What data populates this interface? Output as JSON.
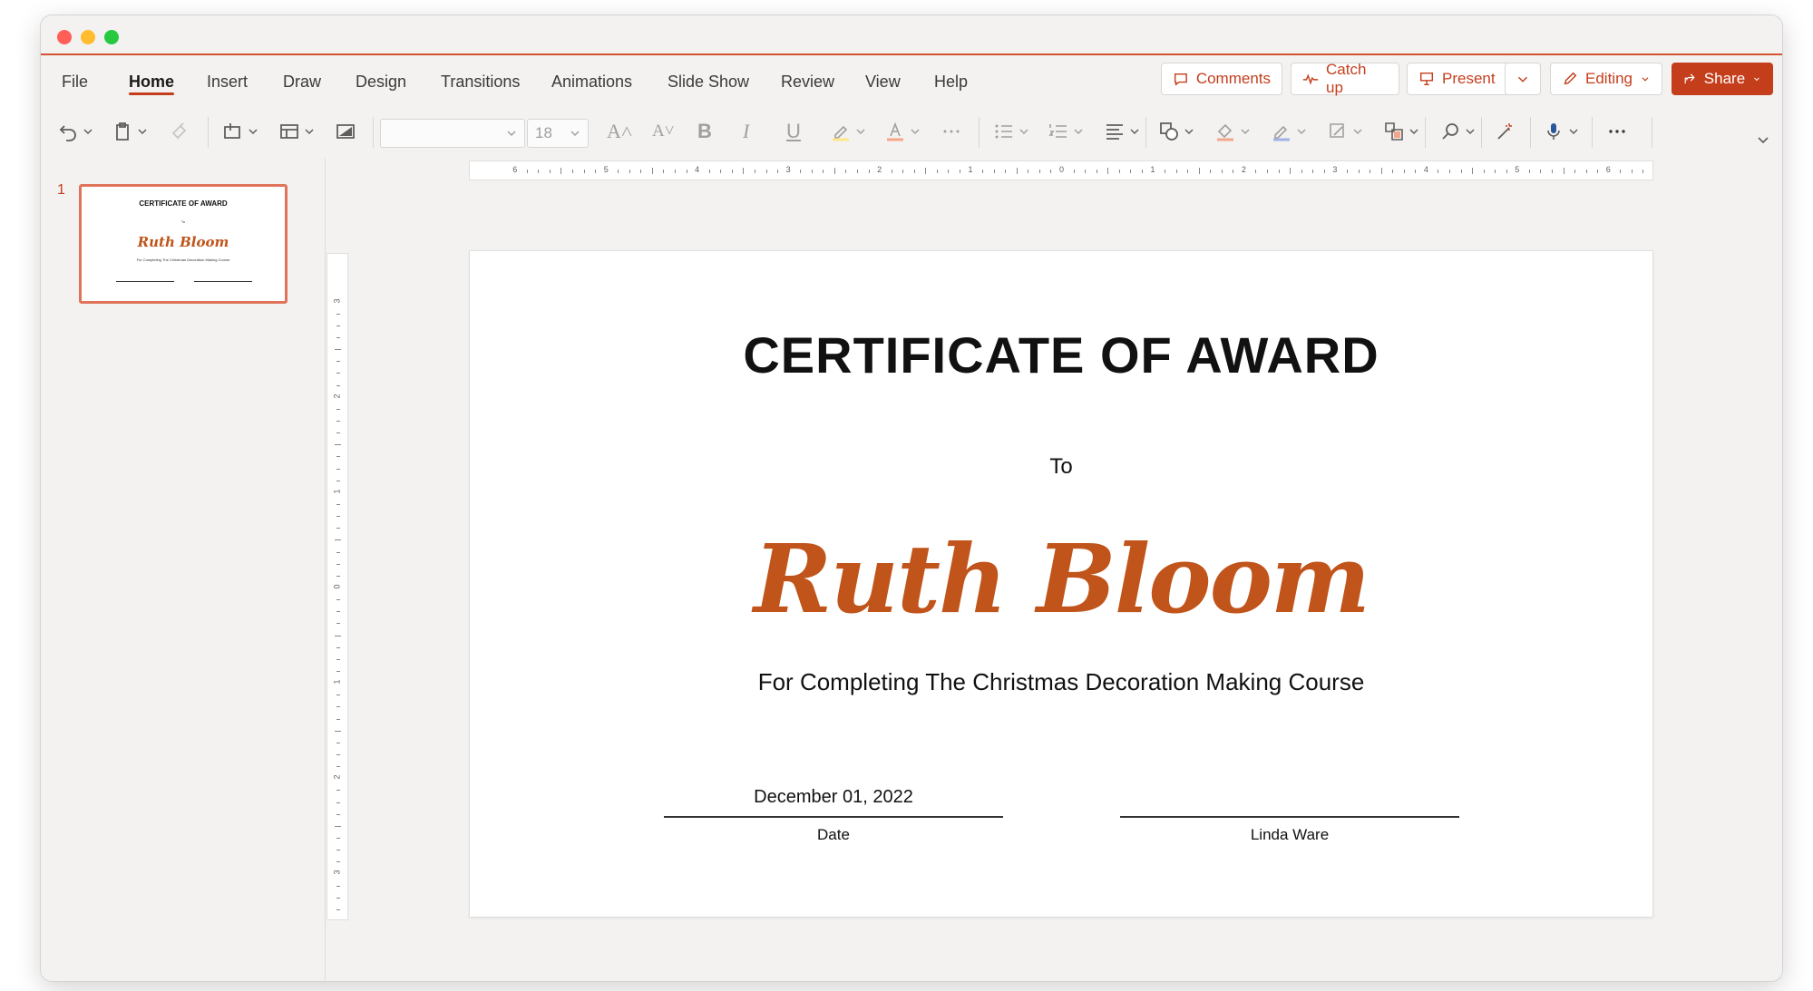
{
  "colors": {
    "accent": "#c43e1c",
    "name_color": "#c0541a",
    "thumb_border": "#e0745a"
  },
  "ribbon": {
    "tabs": [
      {
        "label": "File"
      },
      {
        "label": "Home"
      },
      {
        "label": "Insert"
      },
      {
        "label": "Draw"
      },
      {
        "label": "Design"
      },
      {
        "label": "Transitions"
      },
      {
        "label": "Animations"
      },
      {
        "label": "Slide Show"
      },
      {
        "label": "Review"
      },
      {
        "label": "View"
      },
      {
        "label": "Help"
      }
    ],
    "active_tab": "Home",
    "buttons": {
      "comments": "Comments",
      "catch_up": "Catch up",
      "present": "Present",
      "editing": "Editing",
      "share": "Share"
    }
  },
  "toolbar": {
    "font_size": "18",
    "icons": [
      "undo-icon",
      "clipboard-icon",
      "format-painter-icon",
      "new-slide-icon",
      "layout-icon",
      "background-icon",
      "increase-font-icon",
      "decrease-font-icon",
      "bold-icon",
      "italic-icon",
      "underline-icon",
      "highlight-icon",
      "font-color-icon",
      "more-icon",
      "bullets-icon",
      "numbering-icon",
      "align-icon",
      "shapes-icon",
      "fill-icon",
      "outline-icon",
      "shape-effects-icon",
      "arrange-icon",
      "find-icon",
      "designer-icon",
      "dictate-icon",
      "more-options-icon"
    ]
  },
  "thumbnails": {
    "slide_number": "1",
    "title": "CERTIFICATE OF AWARD",
    "to": "To",
    "name": "Ruth Bloom",
    "line": "For Completing The Christmas Decoration Making Course"
  },
  "ruler": {
    "horizontal_labels": [
      "6",
      "5",
      "4",
      "3",
      "2",
      "1",
      "0",
      "1",
      "2",
      "3",
      "4",
      "5",
      "6"
    ],
    "vertical_labels": [
      "3",
      "2",
      "1",
      "0",
      "1",
      "2",
      "3"
    ]
  },
  "slide": {
    "title": "CERTIFICATE OF AWARD",
    "to": "To",
    "recipient": "Ruth Bloom",
    "reason": "For Completing The Christmas Decoration Making Course",
    "date_value": "December 01, 2022",
    "date_label": "Date",
    "signer_name": "Linda Ware"
  }
}
